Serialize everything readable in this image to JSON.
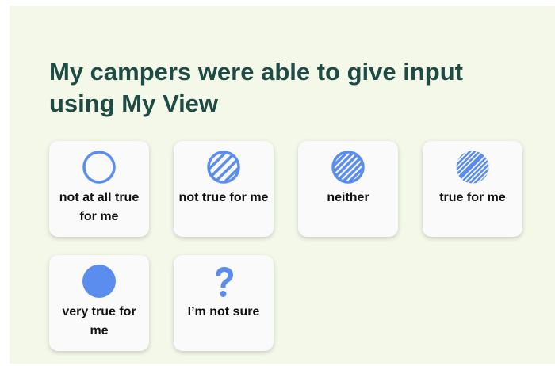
{
  "question": {
    "title": "My campers were able to give input using My View"
  },
  "options": [
    {
      "label": "not at all true for me",
      "icon": "empty-circle-icon"
    },
    {
      "label": "not true for me",
      "icon": "sparse-hatched-circle-icon"
    },
    {
      "label": "neither",
      "icon": "hatched-circle-icon"
    },
    {
      "label": "true for me",
      "icon": "dense-hatched-circle-icon"
    },
    {
      "label": "very true for me",
      "icon": "filled-circle-icon"
    },
    {
      "label": "I’m not sure",
      "icon": "question-mark-icon"
    }
  ],
  "colors": {
    "background": "#f3f8e9",
    "heading": "#1f4b45",
    "accent": "#5b8def",
    "card": "#fafafa"
  }
}
